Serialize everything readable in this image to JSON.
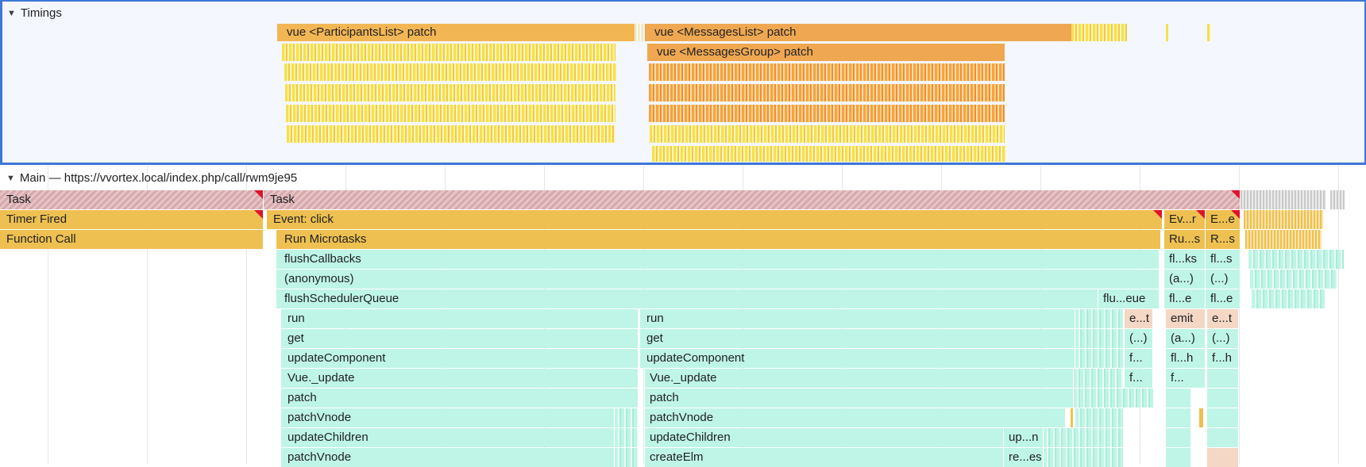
{
  "timings": {
    "header": "Timings",
    "bars": {
      "participants_patch": "vue <ParticipantsList> patch",
      "messages_patch": "vue <MessagesList> patch",
      "messages_group_patch": "vue <MessagesGroup> patch"
    }
  },
  "main": {
    "header": "Main — https://vvortex.local/index.php/call/rwm9je95",
    "rows": {
      "task_left": "Task",
      "task_main": "Task",
      "timer_fired": "Timer Fired",
      "event_click": "Event: click",
      "event_r": "Ev...r",
      "event_e": "E...e",
      "function_call": "Function Call",
      "run_microtasks": "Run Microtasks",
      "run_s1": "Ru...s",
      "run_s2": "R...s",
      "flush_callbacks": "flushCallbacks",
      "flks": "fl...ks",
      "fls": "fl...s",
      "anonymous": "(anonymous)",
      "anon_a": "(a...)",
      "anon_b": "(...)",
      "flush_scheduler_queue": "flushSchedulerQueue",
      "flu_eue": "flu...eue",
      "fle1": "fl...e",
      "fle2": "fl...e",
      "run1": "run",
      "run2": "run",
      "et1": "e...t",
      "emit": "emit",
      "et2": "e...t",
      "get1": "get",
      "get2": "get",
      "get_dots": "(...)",
      "get_a": "(a...)",
      "get_b": "(...)",
      "update_component1": "updateComponent",
      "update_component2": "updateComponent",
      "uc_f": "f...",
      "uc_flh": "fl...h",
      "uc_fh": "f...h",
      "vue_update1": "Vue._update",
      "vue_update2": "Vue._update",
      "vu_f1": "f...",
      "vu_f2": "f...",
      "patch1": "patch",
      "patch2": "patch",
      "patch_vnode1": "patchVnode",
      "patch_vnode2": "patchVnode",
      "update_children1": "updateChildren",
      "update_children2": "updateChildren",
      "up_n": "up...n",
      "patch_vnode3": "patchVnode",
      "create_elm": "createElm",
      "re_es": "re...es"
    }
  },
  "colors": {
    "timing_bar": "#f2b654",
    "task_hatch": "#d7a8ac",
    "scripting_yellow": "#eec051",
    "js_teal": "#bff5e6",
    "long_task_marker": "#e0132a",
    "selection_border": "#3c78d8"
  }
}
